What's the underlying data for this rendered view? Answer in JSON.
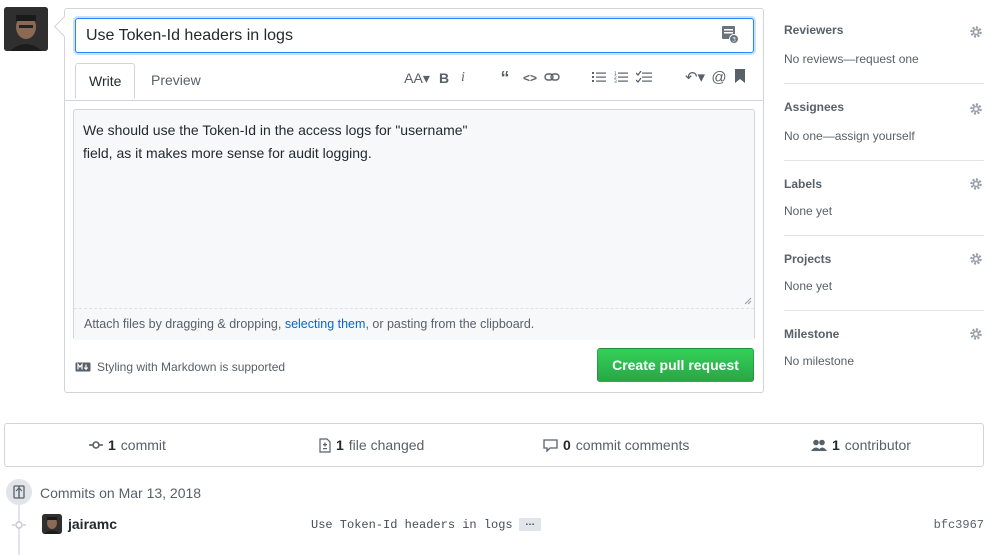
{
  "pull_request": {
    "title_value": "Use Token-Id headers in logs",
    "tabs": [
      {
        "label": "Write"
      },
      {
        "label": "Preview"
      }
    ],
    "body_lines": [
      "We should use the Token-Id in the access logs for \"username\"",
      "field, as it makes more sense for audit logging."
    ],
    "attach_prefix": "Attach files by dragging & dropping, ",
    "attach_link": "selecting them",
    "attach_suffix": ", or pasting from the clipboard.",
    "markdown_note": "Styling with Markdown is supported",
    "create_button": "Create pull request",
    "toolbar_icons": [
      "text-size-icon",
      "bold-icon",
      "italic-icon",
      "quote-icon",
      "code-icon",
      "link-icon",
      "unordered-list-icon",
      "ordered-list-icon",
      "task-list-icon",
      "reply-icon",
      "mention-icon",
      "bookmark-icon"
    ]
  },
  "sidebar": {
    "sections": [
      {
        "heading": "Reviewers",
        "value": "No reviews—request one"
      },
      {
        "heading": "Assignees",
        "value": "No one—assign yourself"
      },
      {
        "heading": "Labels",
        "value": "None yet"
      },
      {
        "heading": "Projects",
        "value": "None yet"
      },
      {
        "heading": "Milestone",
        "value": "No milestone"
      }
    ]
  },
  "stats": {
    "commits_count": "1",
    "commits_label": "commit",
    "files_count": "1",
    "files_label": "file changed",
    "comments_count": "0",
    "comments_label": "commit comments",
    "contributors_count": "1",
    "contributors_label": "contributor"
  },
  "commits": {
    "date_heading": "Commits on Mar 13, 2018",
    "items": [
      {
        "author": "jairamc",
        "message": "Use Token-Id headers in logs",
        "more": "…",
        "sha": "bfc3967"
      }
    ]
  },
  "colors": {
    "accent": "#0366d6",
    "button_green": "#28a745",
    "border": "#d1d5da",
    "muted_text": "#586069"
  }
}
